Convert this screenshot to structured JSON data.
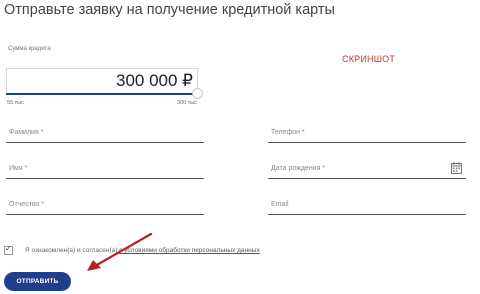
{
  "page": {
    "title": "Отправьте заявку на получение кредитной карты"
  },
  "amount": {
    "label": "Сумма кредита",
    "value": "300 000 ₽",
    "min_label": "55 тыс",
    "max_label": "300 тыс",
    "slider_fraction": 1.0
  },
  "annotation": {
    "stamp": "СКРИНШОТ"
  },
  "form": {
    "surname_placeholder": "Фамилия *",
    "phone_placeholder": "Телефон *",
    "name_placeholder": "Имя *",
    "birthdate_placeholder": "Дата рождения *",
    "patronymic_placeholder": "Отчество *",
    "email_placeholder": "Email"
  },
  "consent": {
    "checked": true,
    "text": "Я ознакомлен(а) и согласен(а) ",
    "link_text": "с условиями обработки персональных данных"
  },
  "actions": {
    "submit_label": "ОТПРАВИТЬ"
  },
  "colors": {
    "accent": "#1f3f8c",
    "stamp": "#c0392b",
    "arrow": "#b22222"
  }
}
